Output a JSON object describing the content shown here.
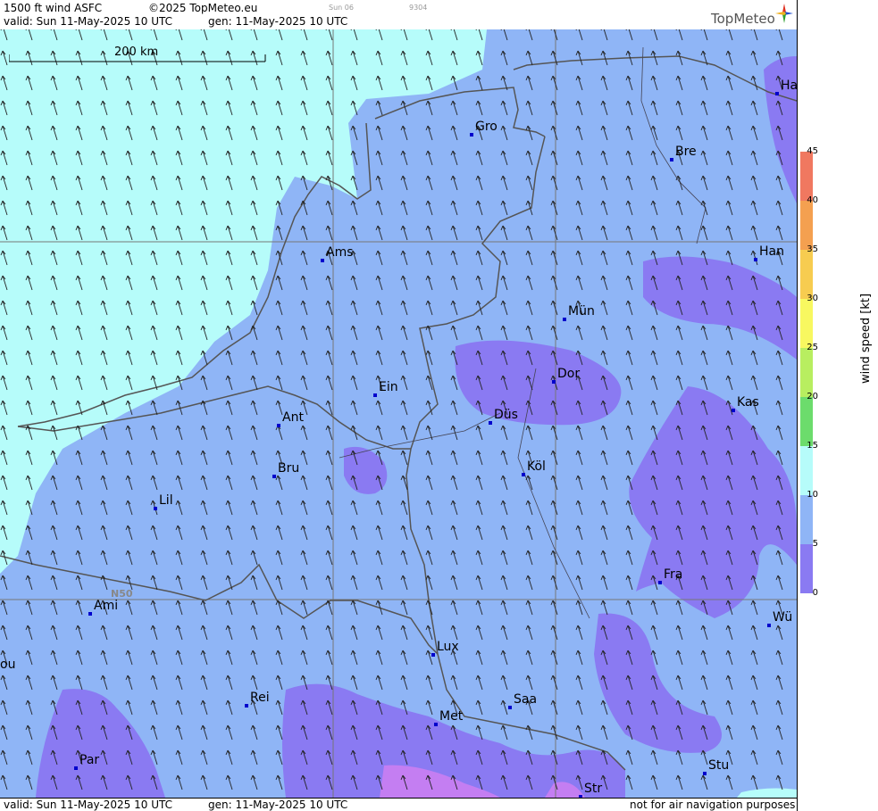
{
  "header": {
    "product": "1500 ft wind ASFC",
    "copyright": "©2025 TopMeteo.eu",
    "run": "Sun 06",
    "code": "9304",
    "valid": "valid:  Sun  11-May-2025  10 UTC",
    "gen": "gen: 11-May-2025 10 UTC",
    "logo": "TopMeteo"
  },
  "footer": {
    "valid": "valid:  Sun  11-May-2025  10 UTC",
    "gen": "gen: 11-May-2025 10 UTC",
    "disclaimer": "not for air navigation purposes"
  },
  "map": {
    "scale_label": "200 km",
    "lat_label": "N50",
    "cities": [
      {
        "name": "Gro"
      },
      {
        "name": "Bre"
      },
      {
        "name": "Ha"
      },
      {
        "name": "Ams"
      },
      {
        "name": "Han"
      },
      {
        "name": "Mün"
      },
      {
        "name": "Ein"
      },
      {
        "name": "Dor"
      },
      {
        "name": "Ant"
      },
      {
        "name": "Düs"
      },
      {
        "name": "Kas"
      },
      {
        "name": "Bru"
      },
      {
        "name": "Köl"
      },
      {
        "name": "Lil"
      },
      {
        "name": "Fra"
      },
      {
        "name": "Ami"
      },
      {
        "name": "Wü"
      },
      {
        "name": "Lux"
      },
      {
        "name": "ou"
      },
      {
        "name": "Rei"
      },
      {
        "name": "Saa"
      },
      {
        "name": "Met"
      },
      {
        "name": "Par"
      },
      {
        "name": "Stu"
      },
      {
        "name": "Str"
      }
    ]
  },
  "legend": {
    "title": "wind speed [kt]",
    "ticks": [
      "45",
      "40",
      "35",
      "30",
      "25",
      "20",
      "15",
      "10",
      "5",
      "0"
    ],
    "colors": [
      "#f07860",
      "#f4a050",
      "#f7cc50",
      "#f8f860",
      "#b8ee60",
      "#6cdc6c",
      "#b6fcfa",
      "#8fb5f6",
      "#8a7af2",
      "#c47ef2"
    ]
  },
  "colors": {
    "light_band": "#b6fcfa",
    "base": "#8fb5f6",
    "purple": "#8a7af2",
    "violet": "#c47ef2"
  }
}
